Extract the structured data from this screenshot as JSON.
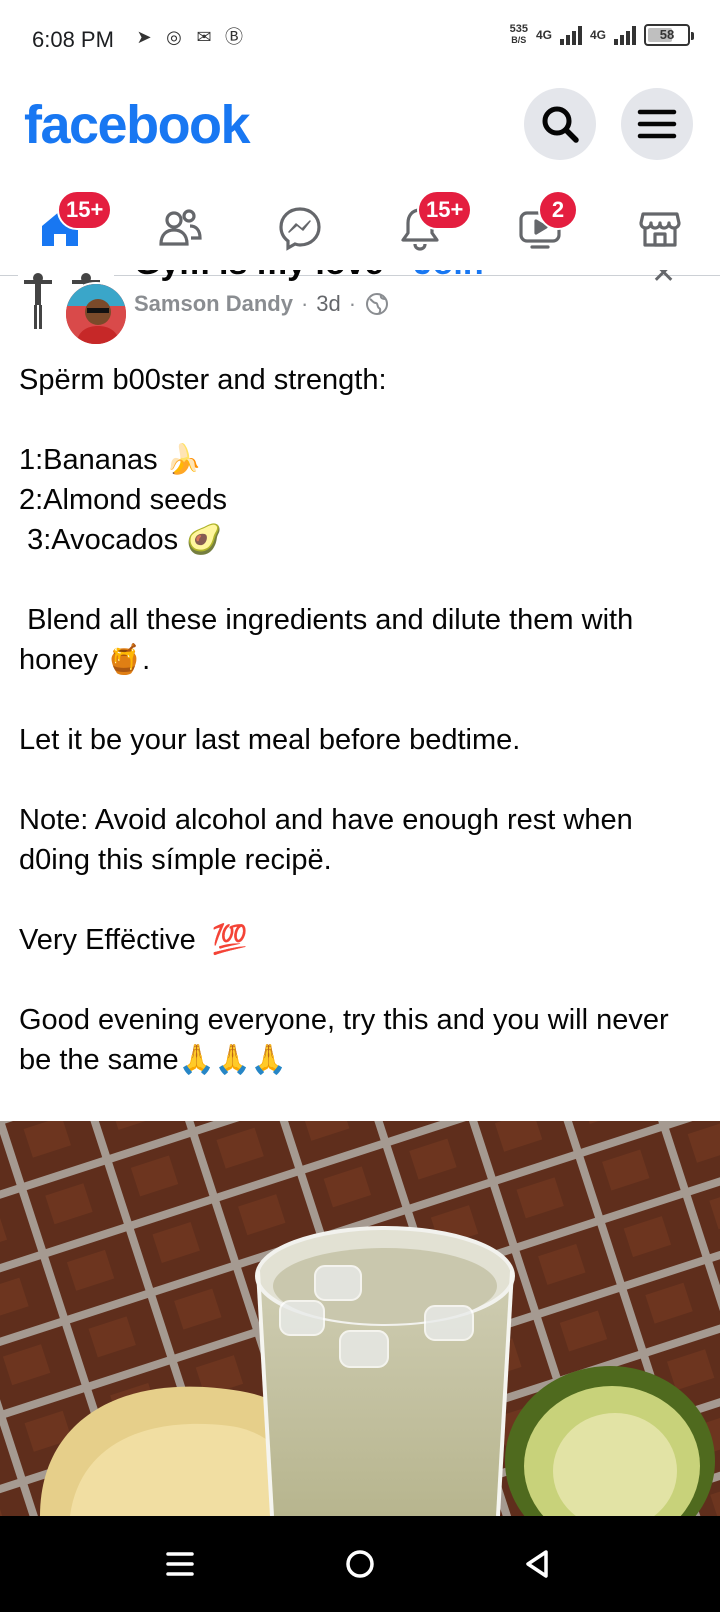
{
  "status_bar": {
    "time": "6:08 PM",
    "speed_value": "535",
    "speed_unit": "B/S",
    "network_1": "4G",
    "network_2": "4G",
    "battery": "58"
  },
  "header": {
    "logo": "facebook",
    "search_icon": "search-icon",
    "menu_icon": "hamburger-menu-icon"
  },
  "tabs": [
    {
      "name": "home",
      "icon": "home-icon",
      "badge": "15+",
      "active": true
    },
    {
      "name": "friends",
      "icon": "friends-icon",
      "badge": ""
    },
    {
      "name": "messenger",
      "icon": "messenger-icon",
      "badge": ""
    },
    {
      "name": "notifications",
      "icon": "bell-icon",
      "badge": "15+"
    },
    {
      "name": "video",
      "icon": "video-icon",
      "badge": "2"
    },
    {
      "name": "marketplace",
      "icon": "marketplace-icon",
      "badge": ""
    }
  ],
  "post": {
    "group_name": "Gym is my love",
    "separator": "·",
    "join_label": "Join",
    "more_label": "···",
    "close_label": "✕",
    "author": "Samson Dandy",
    "time": "3d",
    "privacy_icon": "globe-icon",
    "lines": [
      "Spërm b00ster and strength:",
      "",
      "1:Bananas 🍌",
      "2:Almond seeds",
      " 3:Avocados 🥑",
      "",
      " Blend all these ingredients and dilute them with honey 🍯.",
      "",
      "Let it be your last meal before bedtime.",
      "",
      "Note: Avoid alcohol and have enough rest when d0ing this símple recipë.",
      "",
      "Very Effëctive  💯",
      "",
      "Good evening everyone, try this and you will never be the same🙏🙏🙏"
    ]
  },
  "colors": {
    "brand": "#1877f2",
    "badge": "#e41e3f",
    "secondary_text": "#65676b"
  }
}
